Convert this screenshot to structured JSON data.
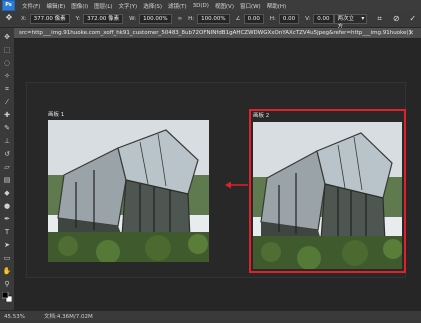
{
  "menu": {
    "logo": "Ps",
    "items": [
      "文件(F)",
      "编辑(E)",
      "图像(I)",
      "图层(L)",
      "文字(Y)",
      "选择(S)",
      "滤镜(T)",
      "3D(D)",
      "视图(V)",
      "窗口(W)",
      "帮助(H)"
    ]
  },
  "options": {
    "x_label": "X:",
    "x_value": "377.00 像素",
    "y_label": "Y:",
    "y_value": "372.00 像素",
    "w_label": "W:",
    "w_value": "100.00%",
    "h_label": "H:",
    "h_value": "100.00%",
    "angle_value": "0.00",
    "hskew_label": "H:",
    "hskew_value": "0.00",
    "vskew_label": "V:",
    "vskew_value": "0.00",
    "interp_value": "两次立方"
  },
  "tab": {
    "title": "src=http___img.91huoke.com_xoff_hk91_customer_50483_8ub72OFNINfdB1gAHCZWDWGXxOnYAXcTZV4u5jpeg&refer=http___img.91huoke(1).jpg @ 45.5% (画...",
    "close": "✕"
  },
  "artboards": [
    {
      "label": "画板 1"
    },
    {
      "label": "画板 2"
    }
  ],
  "colors": {
    "selection": "#e0202a",
    "arrow": "#e0202a"
  },
  "status": {
    "zoom": "45.53%",
    "doc": "文档:4.36M/7.02M"
  }
}
